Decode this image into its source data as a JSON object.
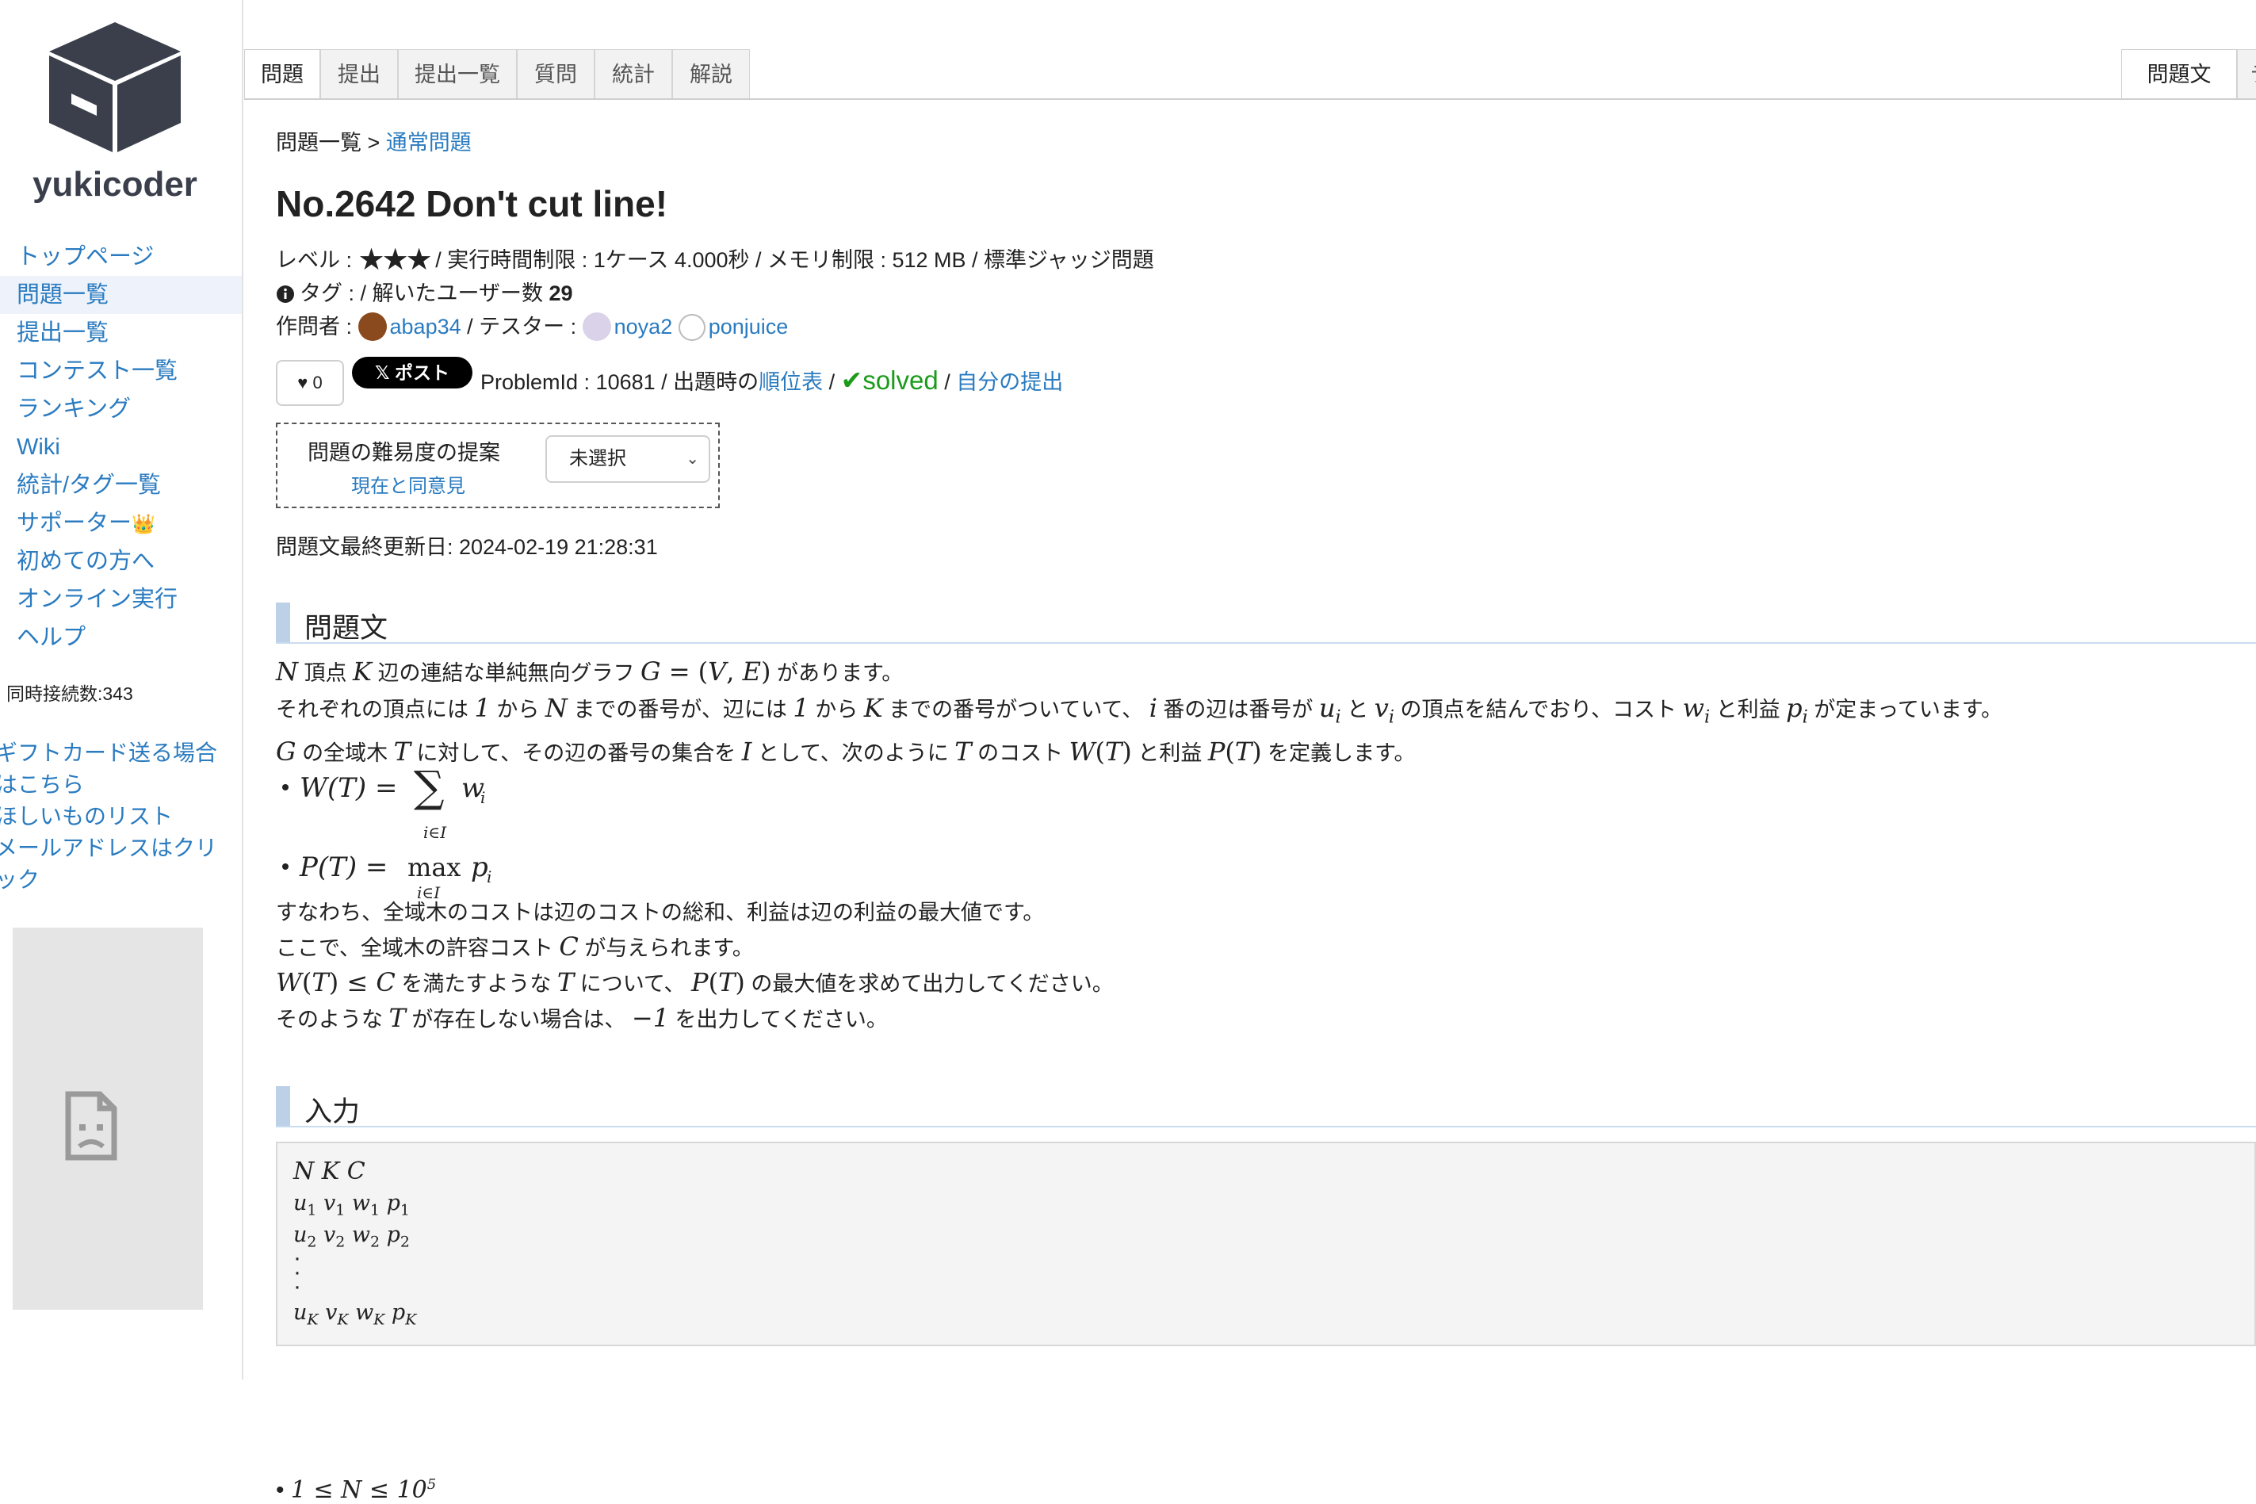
{
  "site": {
    "name": "yukicoder"
  },
  "sidebar": {
    "nav": [
      "トップページ",
      "問題一覧",
      "提出一覧",
      "コンテスト一覧",
      "ランキング",
      "Wiki",
      "統計/タグ一覧",
      "サポーター",
      "初めての方へ",
      "オンライン実行",
      "ヘルプ"
    ],
    "supporter_emoji": "👑",
    "concurrent": "同時接続数:343",
    "gift_link": "ギフトカード送る場合はこちら",
    "wishlist_link": "ほしいものリスト",
    "email_link": "メールアドレスはクリック"
  },
  "tabs": {
    "left": [
      "問題",
      "提出",
      "提出一覧",
      "質問",
      "統計",
      "解説"
    ],
    "right": [
      "問題文",
      "テ"
    ]
  },
  "breadcrumb": {
    "root": "問題一覧",
    "sep": " > ",
    "current": "通常問題"
  },
  "problem": {
    "title": "No.2642 Don't cut line!",
    "level_label": "レベル : ",
    "stars": 3,
    "limits": " / 実行時間制限 : 1ケース 4.000秒 / メモリ制限 : 512 MB / 標準ジャッジ問題",
    "tag_label": "タグ : / 解いたユーザー数 ",
    "solved_users": "29",
    "author_label": "作問者 : ",
    "author": "abap34",
    "tester_label": " / テスター : ",
    "testers": [
      "noya2",
      "ponjuice"
    ],
    "likes": "0",
    "post_label": "ポスト",
    "problem_id_text": "ProblemId : 10681 / 出題時の",
    "standings_link": "順位表",
    "sep": " / ",
    "solved_text": "solved",
    "my_submissions_link": "自分の提出",
    "difficulty_title": "問題の難易度の提案",
    "difficulty_link": "現在と同意見",
    "difficulty_select": "未選択",
    "last_updated": "問題文最終更新日: 2024-02-19 21:28:31"
  },
  "sections": {
    "statement_heading": "問題文",
    "input_heading": "入力"
  },
  "statement": {
    "l1a": "頂点 ",
    "l1b": " 辺の連結な単純無向グラフ ",
    "l1c": " があります。",
    "l2a": "それぞれの頂点には ",
    "l2b": " から ",
    "l2c": " までの番号が、辺には ",
    "l2d": " から ",
    "l2e": " までの番号がついていて、 ",
    "l2f": " 番の辺は番号が ",
    "l2g": " と ",
    "l2h": " の頂点を結んでおり、コスト ",
    "l2i": " と利益 ",
    "l2j": " が定まっています。",
    "l3a": " の全域木 ",
    "l3b": " に対して、その辺の番号の集合を ",
    "l3c": " として、次のように ",
    "l3d": " のコスト ",
    "l3e": " と利益 ",
    "l3f": " を定義します。",
    "s1": "すなわち、全域木のコストは辺のコストの総和、利益は辺の利益の最大値です。",
    "s2a": "ここで、全域木の許容コスト ",
    "s2b": " が与えられます。",
    "s3a": " を満たすような ",
    "s3b": " について、 ",
    "s3c": " の最大値を求めて出力してください。",
    "s4a": "そのような ",
    "s4b": " が存在しない場合は、 ",
    "s4c": " を出力してください。"
  }
}
